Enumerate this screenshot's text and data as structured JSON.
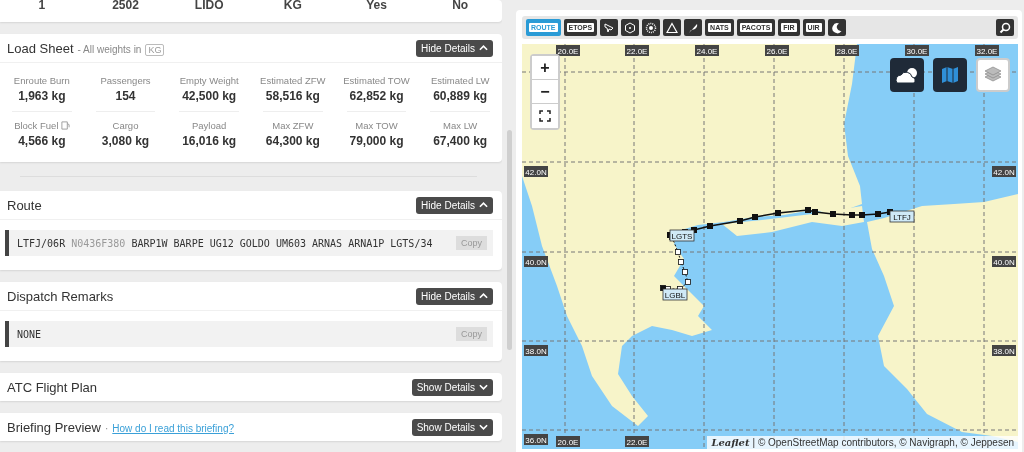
{
  "summary_row": [
    "1",
    "2502",
    "LIDO",
    "KG",
    "Yes",
    "No"
  ],
  "load_sheet": {
    "title": "Load Sheet",
    "subtitle": "- All weights in",
    "unit": "KG",
    "toggle": {
      "label": "Hide Details",
      "expanded": true
    },
    "items": [
      {
        "label": "Enroute Burn",
        "value": "1,963 kg"
      },
      {
        "label": "Passengers",
        "value": "154"
      },
      {
        "label": "Empty Weight",
        "value": "42,500 kg"
      },
      {
        "label": "Estimated ZFW",
        "value": "58,516 kg"
      },
      {
        "label": "Estimated TOW",
        "value": "62,852 kg"
      },
      {
        "label": "Estimated LW",
        "value": "60,889 kg"
      },
      {
        "label": "Block Fuel",
        "value": "4,566 kg",
        "kind": "fuel"
      },
      {
        "label": "Cargo",
        "value": "3,080 kg"
      },
      {
        "label": "Payload",
        "value": "16,016 kg"
      },
      {
        "label": "Max ZFW",
        "value": "64,300 kg"
      },
      {
        "label": "Max TOW",
        "value": "79,000 kg"
      },
      {
        "label": "Max LW",
        "value": "67,400 kg"
      }
    ]
  },
  "sections": [
    {
      "title": "Route",
      "toggle": {
        "label": "Hide Details",
        "expanded": true
      },
      "content": [
        {
          "text": "LTFJ/06R",
          "dim": false
        },
        {
          "text": "N0436F380",
          "dim": true
        },
        {
          "text": "BARP1W BARPE UG12 GOLDO UM603 ARNAS ARNA1P LGTS/34",
          "dim": false
        }
      ],
      "copy": "Copy"
    },
    {
      "title": "Dispatch Remarks",
      "toggle": {
        "label": "Hide Details",
        "expanded": true
      },
      "content": [
        {
          "text": "NONE",
          "dim": false
        }
      ],
      "copy": "Copy"
    },
    {
      "title": "ATC Flight Plan",
      "toggle": {
        "label": "Show Details",
        "expanded": false
      }
    },
    {
      "title": "Briefing Preview",
      "link_separator": "·",
      "link": "How do I read this briefing?",
      "toggle": {
        "label": "Show Details",
        "expanded": false
      }
    }
  ],
  "map": {
    "toolbar": [
      {
        "kind": "text",
        "label": "ROUTE",
        "selected": true
      },
      {
        "kind": "text",
        "label": "ETOPS",
        "selected": false
      },
      {
        "kind": "plane",
        "selected": false
      },
      {
        "kind": "hexagon",
        "selected": false
      },
      {
        "kind": "dots",
        "selected": false
      },
      {
        "kind": "triangle",
        "selected": false
      },
      {
        "kind": "feather",
        "selected": false
      },
      {
        "kind": "text",
        "label": "NATS",
        "selected": false
      },
      {
        "kind": "text",
        "label": "PACOTS",
        "selected": false
      },
      {
        "kind": "text",
        "label": "FIR",
        "selected": false
      },
      {
        "kind": "text",
        "label": "UIR",
        "selected": false
      },
      {
        "kind": "moon",
        "selected": false
      }
    ],
    "zoom_controls": [
      "+",
      "−"
    ],
    "grid_top": [
      "20.0E",
      "22.0E",
      "24.0E",
      "26.0E",
      "28.0E",
      "30.0E",
      "32.0E"
    ],
    "grid_left": [
      "42.0N",
      "40.0N",
      "38.0N",
      "36.0N"
    ],
    "grid_right": [
      "42.0N",
      "40.0N",
      "38.0N"
    ],
    "grid_bottom": [
      "20.0E",
      "22.0E"
    ],
    "airports": [
      "LTFJ",
      "LGTS",
      "LGBL"
    ],
    "attribution_link": "Leaflet",
    "attribution": "| © OpenStreetMap contributors, © Navigraph, © Jeppesen"
  }
}
